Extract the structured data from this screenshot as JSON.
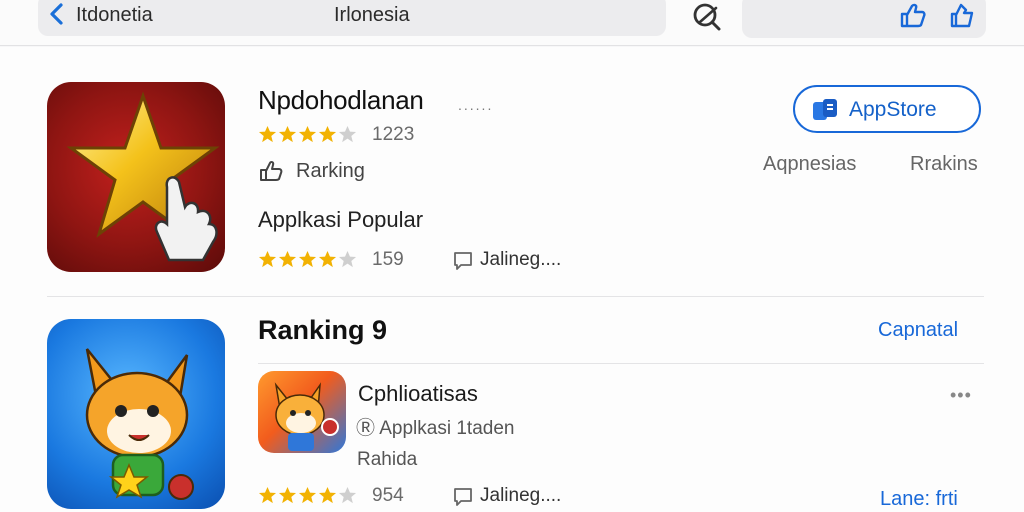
{
  "topbar": {
    "left_text": "Itdonetia",
    "center_text": "Irlonesia"
  },
  "app1": {
    "title": "Npdohodlanan",
    "title_dots": "......",
    "rating_stars": 4,
    "rating_count": "1223",
    "rank_label": "Rarking",
    "category": "Applkasi Popular",
    "rating2_stars": 4,
    "rating2_count": "159",
    "online_label": "Jalineg....",
    "appstore_button": "AppStore",
    "right_label_a": "Aqpnesias",
    "right_label_b": "Rrakins"
  },
  "section": {
    "title": "Ranking 9",
    "see_all": "Capnatal"
  },
  "app2": {
    "title": "Cphlioatisas",
    "subtitle": "Applkasi 1taden",
    "publisher": "Rahida",
    "rating_stars": 4,
    "rating_count": "954",
    "online_label": "Jalineg....",
    "more": "•••",
    "bottom_link": "Lane: frti"
  },
  "colors": {
    "accent": "#1868d8",
    "star": "#f2b203",
    "star_empty": "#cfcfcf"
  }
}
